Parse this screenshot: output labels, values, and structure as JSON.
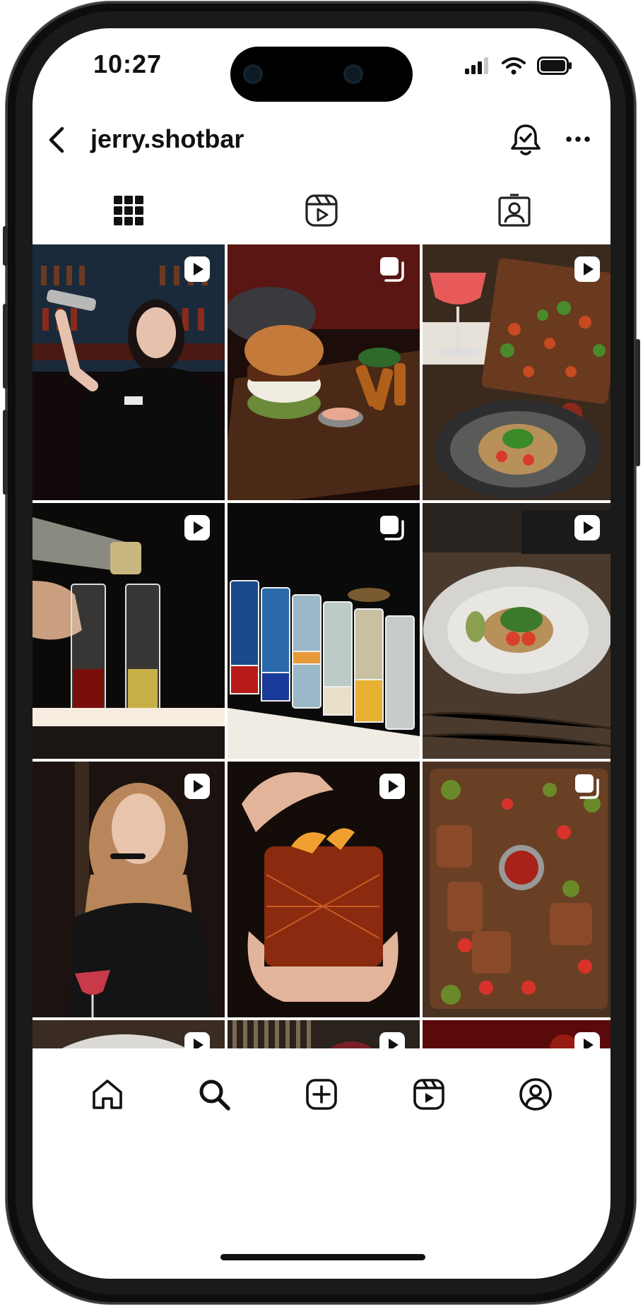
{
  "status_bar": {
    "time": "10:27"
  },
  "profile": {
    "username": "jerry.shotbar"
  },
  "header_icons": [
    "back-arrow-icon",
    "notification-bell-icon",
    "more-options-icon"
  ],
  "tabs": [
    {
      "name": "grid",
      "icon": "grid-icon",
      "active": true
    },
    {
      "name": "reels",
      "icon": "reels-icon",
      "active": false
    },
    {
      "name": "tagged",
      "icon": "tagged-person-icon",
      "active": false
    }
  ],
  "posts": [
    {
      "subject": "bartender-with-shaker",
      "type": "reel"
    },
    {
      "subject": "burger-and-fries",
      "type": "carousel"
    },
    {
      "subject": "cocktail-and-food-platter",
      "type": "reel"
    },
    {
      "subject": "pouring-shots",
      "type": "reel"
    },
    {
      "subject": "layered-shot-glasses",
      "type": "carousel"
    },
    {
      "subject": "plated-dish",
      "type": "reel"
    },
    {
      "subject": "woman-with-cocktail",
      "type": "reel"
    },
    {
      "subject": "whiskey-glass-with-orange",
      "type": "reel"
    },
    {
      "subject": "meat-board",
      "type": "carousel"
    },
    {
      "subject": "pasta-dish",
      "type": "reel"
    },
    {
      "subject": "woman-eating-burger",
      "type": "reel"
    },
    {
      "subject": "red-cocktail",
      "type": "reel"
    }
  ],
  "bottom_nav": [
    "home-icon",
    "search-icon",
    "create-icon",
    "reels-icon",
    "profile-icon"
  ],
  "colors": {
    "text": "#111111",
    "background": "#ffffff",
    "frame": "#0d0d0d"
  }
}
